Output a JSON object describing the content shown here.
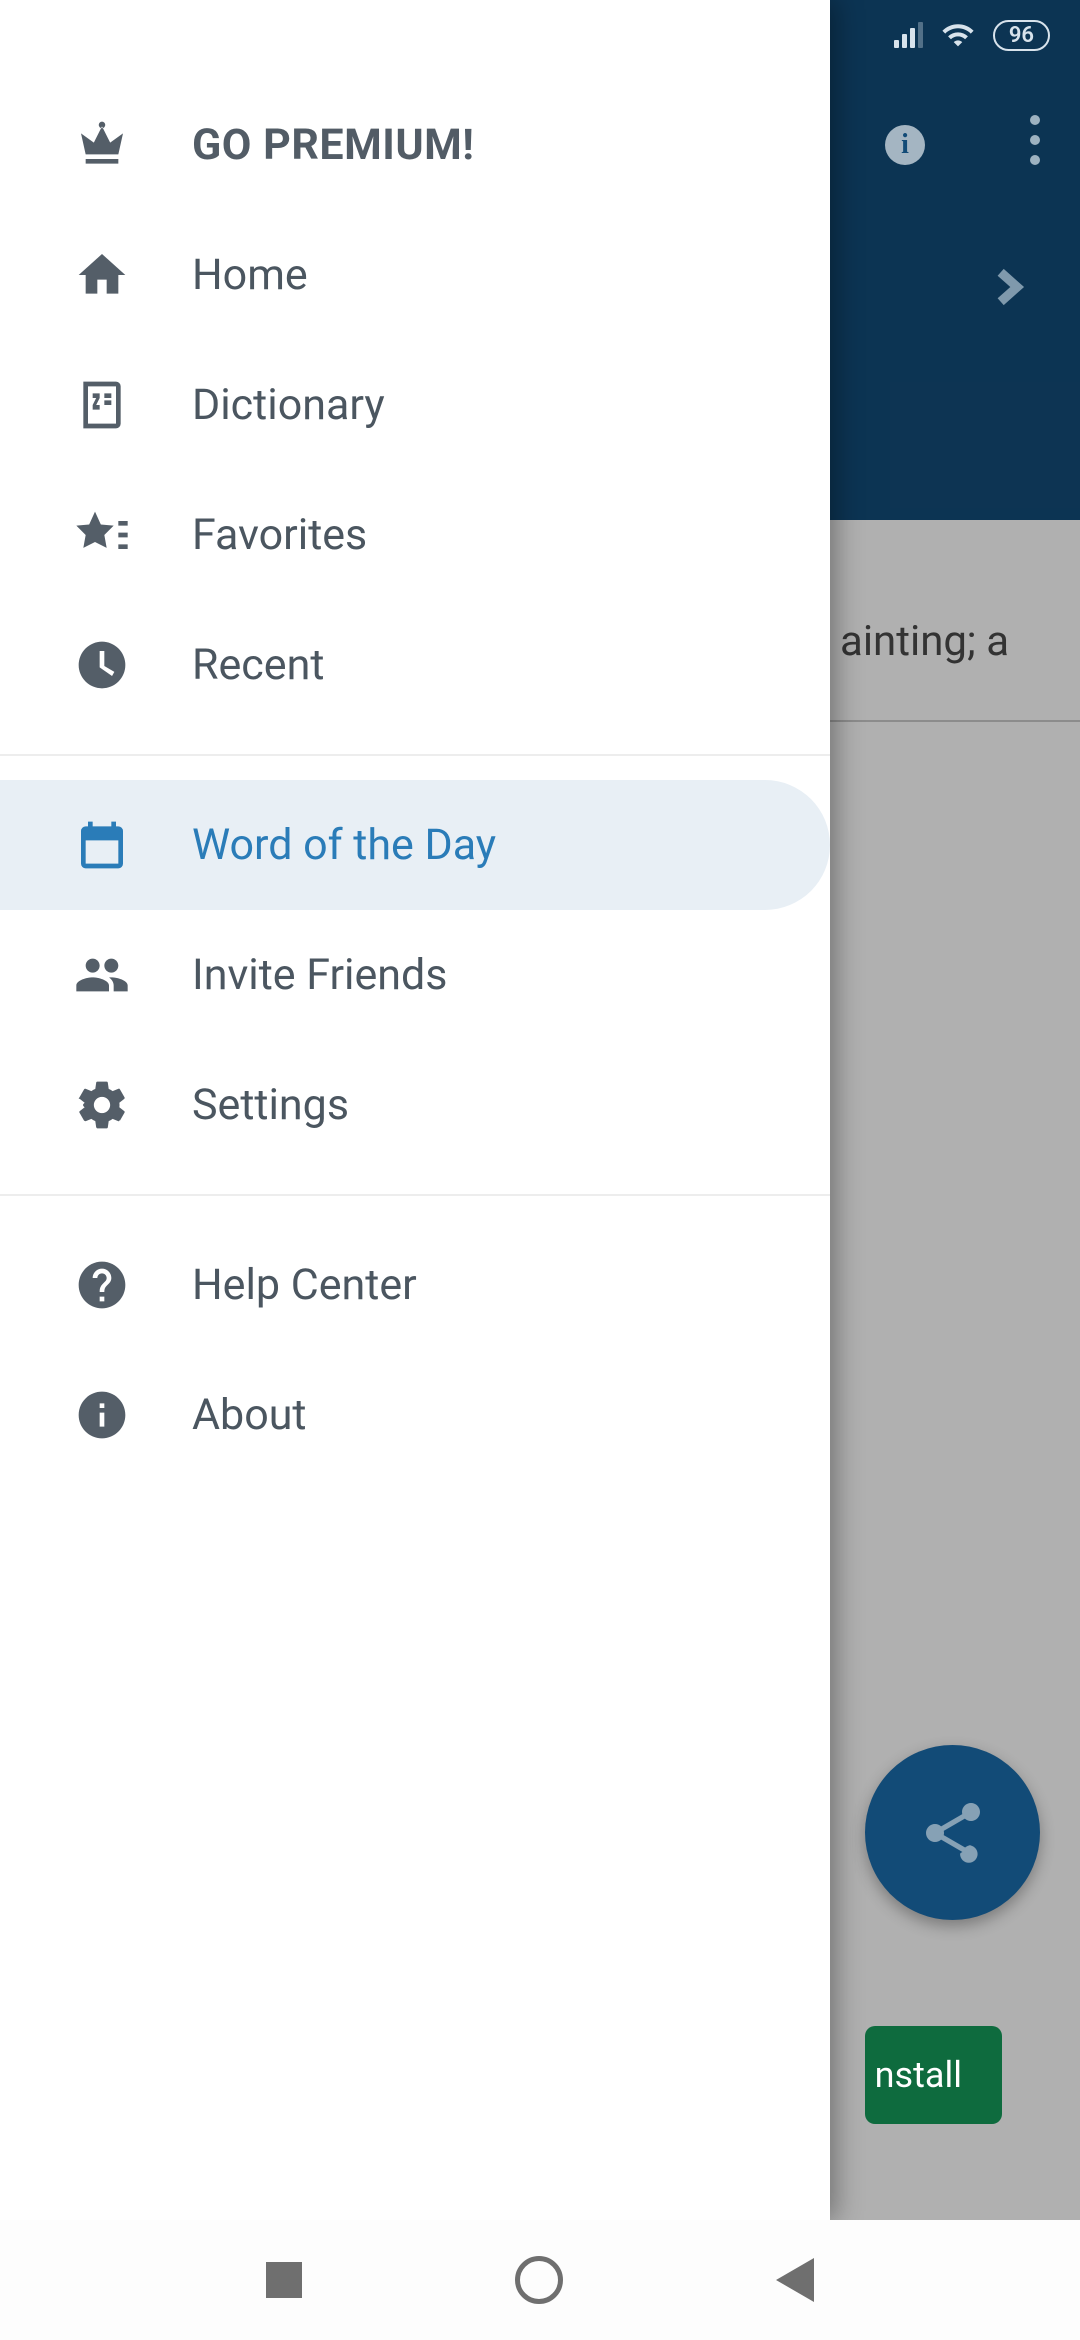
{
  "status": {
    "battery": "96"
  },
  "drawer": {
    "premium": {
      "label": "GO PREMIUM!"
    },
    "items": [
      {
        "label": "Home"
      },
      {
        "label": "Dictionary"
      },
      {
        "label": "Favorites"
      },
      {
        "label": "Recent"
      }
    ],
    "section2": [
      {
        "label": "Word of the Day"
      },
      {
        "label": "Invite Friends"
      },
      {
        "label": "Settings"
      }
    ],
    "section3": [
      {
        "label": "Help Center"
      },
      {
        "label": "About"
      }
    ]
  },
  "background": {
    "text_fragment_1": "ainting; a",
    "install_label": "nstall"
  }
}
